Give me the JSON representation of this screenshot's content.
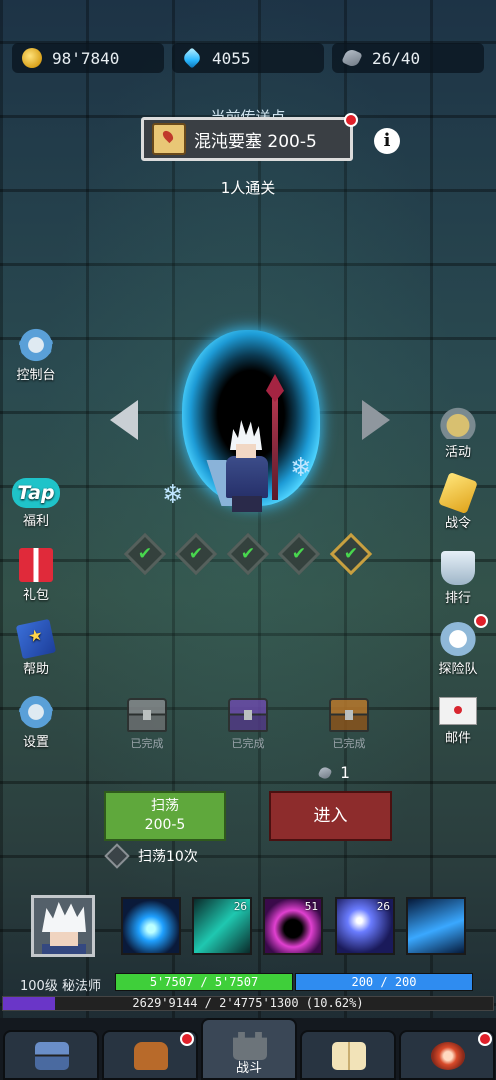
{
  "currency": {
    "gold": "98'7840",
    "gems": "4055",
    "stamina": "26/40"
  },
  "location": {
    "label": "当前传送点",
    "name": "混沌要塞  200-5",
    "clear_info": "1人通关"
  },
  "left_menu": [
    {
      "label": "控制台",
      "icon": "gear-icon"
    },
    {
      "label": "福利",
      "icon": "tap-logo-icon"
    },
    {
      "label": "礼包",
      "icon": "gift-icon"
    },
    {
      "label": "帮助",
      "icon": "book-icon"
    },
    {
      "label": "设置",
      "icon": "gear-icon"
    }
  ],
  "right_menu": [
    {
      "label": "活动",
      "icon": "helmet-icon"
    },
    {
      "label": "战令",
      "icon": "gold-badge-icon"
    },
    {
      "label": "排行",
      "icon": "trophy-icon"
    },
    {
      "label": "探险队",
      "icon": "clock-icon"
    },
    {
      "label": "邮件",
      "icon": "mail-icon"
    }
  ],
  "stage_progress": {
    "completed": 4,
    "total": 5
  },
  "chests": [
    {
      "status": "已完成",
      "color": "#8a8d90"
    },
    {
      "status": "已完成",
      "color": "#6e4bb0"
    },
    {
      "status": "已完成",
      "color": "#c07a2a"
    }
  ],
  "entry_cost": "1",
  "actions": {
    "sweep_line1": "扫荡",
    "sweep_line2": "200-5",
    "enter": "进入",
    "sweep10": "扫荡10次"
  },
  "skills": [
    {
      "level": "",
      "icon": "ice-orb-icon"
    },
    {
      "level": "26",
      "icon": "ice-shard-icon"
    },
    {
      "level": "51",
      "icon": "vortex-icon"
    },
    {
      "level": "26",
      "icon": "staff-icon"
    },
    {
      "level": "",
      "icon": "lightning-icon"
    }
  ],
  "character": {
    "level_class": "100级 秘法师",
    "hp": "5'7507 / 5'7507",
    "mp": "200 / 200",
    "hp_fraction": 1.0,
    "mp_fraction": 1.0,
    "xp": "2629'9144 / 2'4775'1300 (10.62%)",
    "xp_fraction": 0.1062
  },
  "nav": {
    "tabs": [
      {
        "label": "",
        "icon": "chest-icon"
      },
      {
        "label": "",
        "icon": "bag-icon"
      },
      {
        "label": "战斗",
        "icon": "castle-icon"
      },
      {
        "label": "",
        "icon": "open-book-icon"
      },
      {
        "label": "",
        "icon": "rune-icon"
      }
    ]
  },
  "colors": {
    "hp": "#3fcf3a",
    "mp": "#2f8cf0",
    "xp": "#6a36c8",
    "sweep": "#5fa83c",
    "enter": "#8d2c2c",
    "check": "#48d64e",
    "notify": "#e0202a"
  }
}
